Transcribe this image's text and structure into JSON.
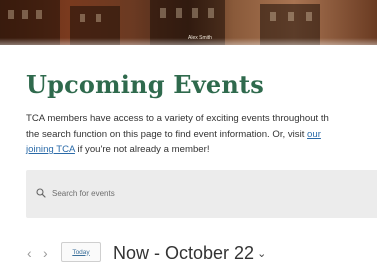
{
  "hero": {
    "caption": "Alex Smith"
  },
  "title": "Upcoming Events",
  "intro": {
    "line1": "TCA members have access to a variety of exciting events throughout th",
    "line2_text": "the search function on this page to find event information. Or, visit ",
    "line2_link": "our",
    "line3_link": "joining TCA",
    "line3_text": " if you're not already a member!"
  },
  "search": {
    "placeholder": "Search for events"
  },
  "calendar": {
    "prev_icon": "chevron-left-icon",
    "next_icon": "chevron-right-icon",
    "today_label": "Today",
    "range_label": "Now - October 22",
    "range_caret": "⌄"
  },
  "colors": {
    "title": "#2f6a4d",
    "link": "#2a6aa8",
    "search_bg": "#ececec"
  }
}
